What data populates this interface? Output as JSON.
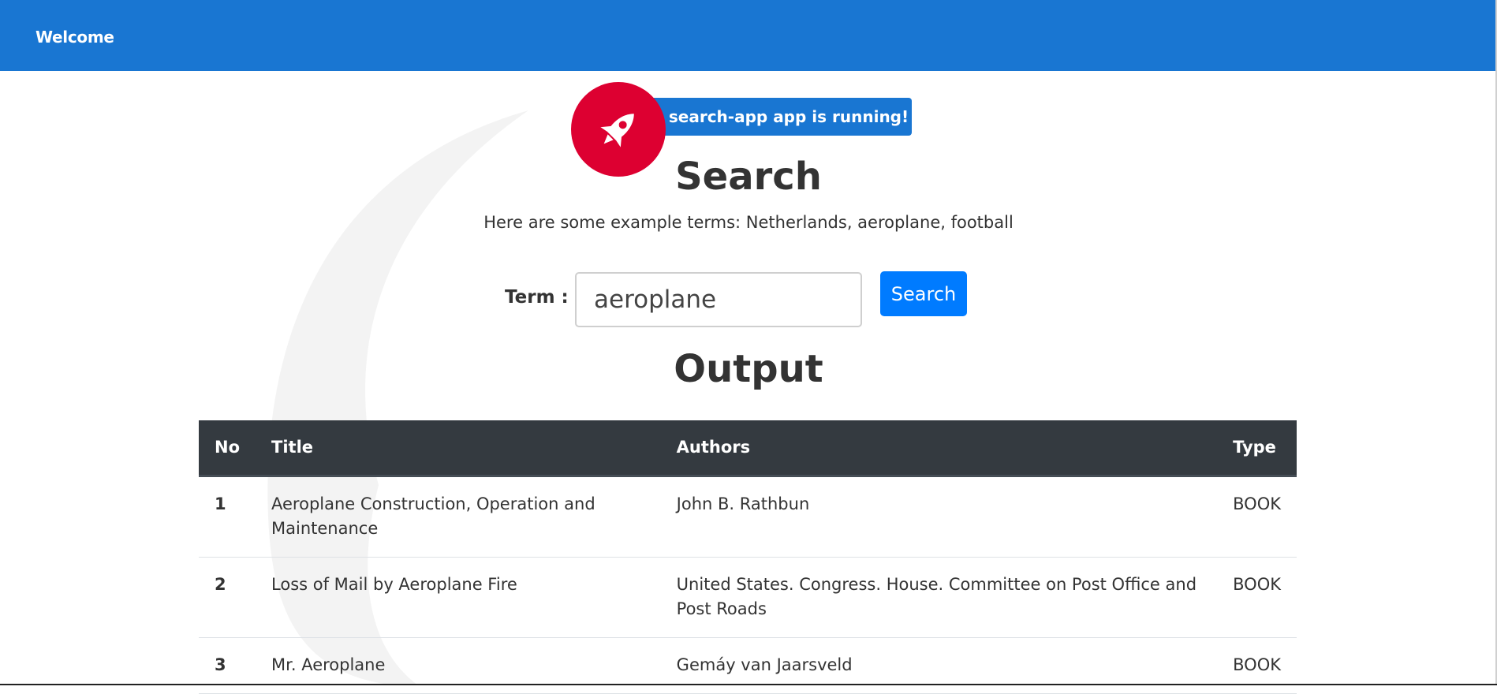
{
  "header": {
    "brand": "Welcome",
    "bar_color": "#1976d2"
  },
  "banner": {
    "icon": "rocket-icon",
    "running_text": "search-app app is running!",
    "circle_color": "#dd0031"
  },
  "search": {
    "title": "Search",
    "examples_text": "Here are some example terms: Netherlands, aeroplane, football",
    "term_label": "Term :",
    "term_value": "aeroplane",
    "button_label": "Search"
  },
  "output": {
    "title": "Output",
    "columns": [
      "No",
      "Title",
      "Authors",
      "Type"
    ],
    "rows": [
      {
        "no": "1",
        "title": "Aeroplane Construction, Operation and Maintenance",
        "authors": "John B. Rathbun",
        "type": "BOOK"
      },
      {
        "no": "2",
        "title": "Loss of Mail by Aeroplane Fire",
        "authors": "United States. Congress. House. Committee on Post Office and Post Roads",
        "type": "BOOK"
      },
      {
        "no": "3",
        "title": "Mr. Aeroplane",
        "authors": "Gemáy van Jaarsveld",
        "type": "BOOK"
      }
    ]
  }
}
